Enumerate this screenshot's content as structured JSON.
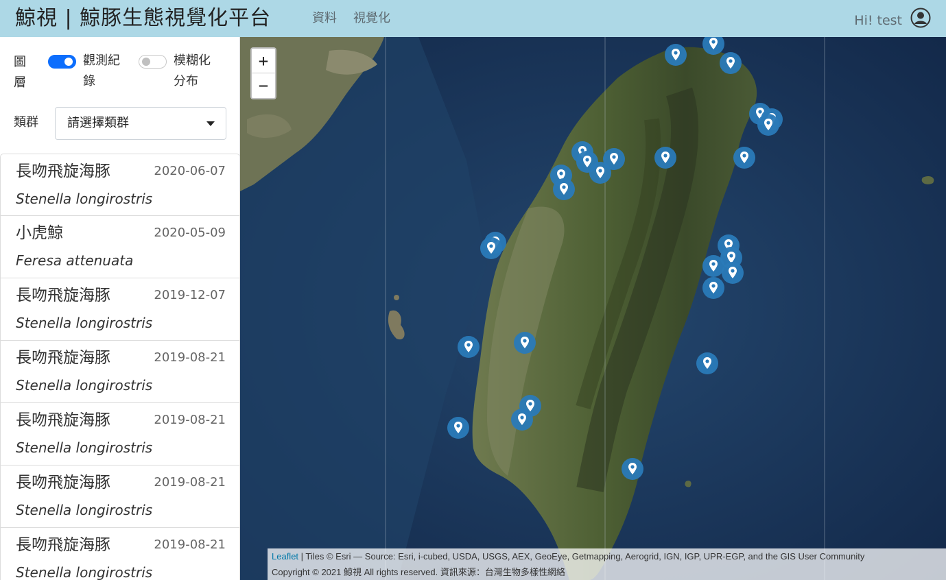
{
  "navbar": {
    "brand": "鯨視 | 鯨豚生態視覺化平台",
    "links": [
      "資料",
      "視覺化"
    ],
    "greeting": "Hi! test",
    "user_icon": "user-circle-icon"
  },
  "sidebar": {
    "layer_label": "圖層",
    "toggles": [
      {
        "label": "觀測紀錄",
        "on": true
      },
      {
        "label": "模糊化分布",
        "on": false
      }
    ],
    "group_label": "類群",
    "group_select": {
      "value": "請選擇類群"
    },
    "records": [
      {
        "name": "長吻飛旋海豚",
        "date": "2020-06-07",
        "scientific": "Stenella longirostris"
      },
      {
        "name": "小虎鯨",
        "date": "2020-05-09",
        "scientific": "Feresa attenuata"
      },
      {
        "name": "長吻飛旋海豚",
        "date": "2019-12-07",
        "scientific": "Stenella longirostris"
      },
      {
        "name": "長吻飛旋海豚",
        "date": "2019-08-21",
        "scientific": "Stenella longirostris"
      },
      {
        "name": "長吻飛旋海豚",
        "date": "2019-08-21",
        "scientific": "Stenella longirostris"
      },
      {
        "name": "長吻飛旋海豚",
        "date": "2019-08-21",
        "scientific": "Stenella longirostris"
      },
      {
        "name": "長吻飛旋海豚",
        "date": "2019-08-21",
        "scientific": "Stenella longirostris"
      }
    ]
  },
  "map": {
    "zoom_in": "+",
    "zoom_out": "−",
    "marker_color": "#2a7ab8",
    "attribution": {
      "leaflet": "Leaflet",
      "tiles": " | Tiles © Esri — Source: Esri, i-cubed, USDA, USGS, AEX, GeoEye, Getmapping, Aerogrid, IGN, IGP, UPR-EGP, and the GIS User Community",
      "copyright": "Copyright © 2021 鯨視 All rights reserved. 資訊來源：台灣生物多樣性網絡"
    }
  }
}
